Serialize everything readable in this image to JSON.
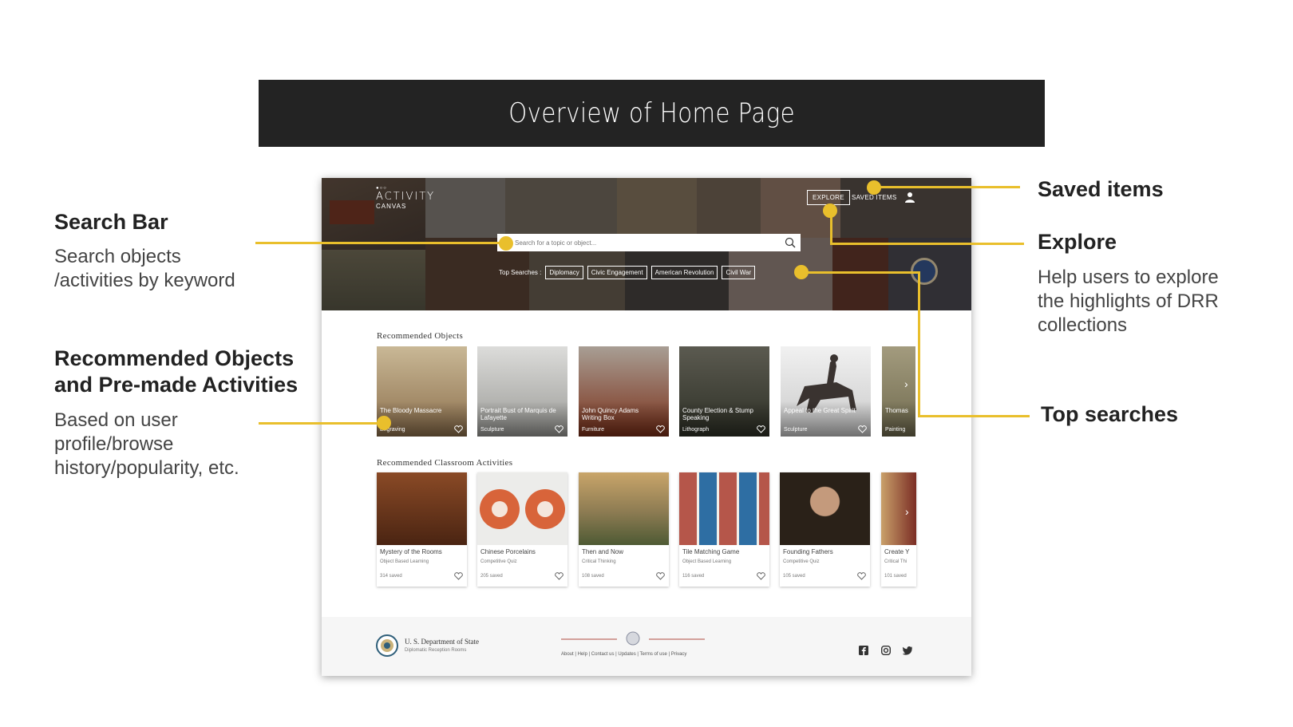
{
  "slide": {
    "title": "Overview of Home Page"
  },
  "annotations": {
    "search_bar": {
      "heading": "Search Bar",
      "body": [
        "Search objects",
        "/activities by keyword"
      ]
    },
    "recommended": {
      "heading_lines": [
        "Recommended Objects",
        "and Pre-made Activities"
      ],
      "body": [
        "Based on user",
        "profile/browse",
        "history/popularity, etc."
      ]
    },
    "saved_items": {
      "heading": "Saved items"
    },
    "explore": {
      "heading": "Explore",
      "body": [
        "Help users to explore",
        "the highlights of DRR",
        "collections"
      ]
    },
    "top_searches": {
      "heading": "Top searches"
    }
  },
  "app": {
    "logo": {
      "dots": "●○○",
      "name": "ACTIVITY",
      "sub": "CANVAS"
    },
    "nav": {
      "explore": "EXPLORE",
      "saved_items": "SAVED ITEMS"
    },
    "search": {
      "placeholder": "Search for a topic or object..."
    },
    "top_searches": {
      "label": "Top Searches :",
      "chips": [
        "Diplomacy",
        "Civic Engagement",
        "American Revolution",
        "Civil War"
      ]
    },
    "recommended_objects": {
      "title": "Recommended Objects",
      "items": [
        {
          "caption": "The Bloody Massacre",
          "category": "Engraving"
        },
        {
          "caption": "Portrait Bust of Marquis de Lafayette",
          "category": "Sculpture"
        },
        {
          "caption": "John Quincy Adams Writing Box",
          "category": "Furniture"
        },
        {
          "caption": "County Election & Stump Speaking",
          "category": "Lithograph"
        },
        {
          "caption": "Appeal to the Great Spirit",
          "category": "Sculpture"
        },
        {
          "caption": "Thomas",
          "category": "Painting"
        }
      ]
    },
    "recommended_activities": {
      "title": "Recommended Classroom Activities",
      "items": [
        {
          "title": "Mystery of the Rooms",
          "type": "Object Based Learning",
          "saved": "314 saved"
        },
        {
          "title": "Chinese Porcelains",
          "type": "Competitive Quiz",
          "saved": "205 saved"
        },
        {
          "title": "Then and Now",
          "type": "Critical Thinking",
          "saved": "108 saved"
        },
        {
          "title": "Tile Matching Game",
          "type": "Object Based Learning",
          "saved": "116 saved"
        },
        {
          "title": "Founding Fathers",
          "type": "Competitive Quiz",
          "saved": "105 saved"
        },
        {
          "title": "Create Y",
          "type": "Critical Thi",
          "saved": "101 saved"
        }
      ]
    },
    "footer": {
      "dept": "U. S. Department of State",
      "dept_sub": "Diplomatic Reception Rooms",
      "links": "About |  Help |  Contact us |  Updates |  Terms of use | Privacy"
    }
  },
  "colors": {
    "accent": "#e9bf2c",
    "title_band": "#232323"
  }
}
